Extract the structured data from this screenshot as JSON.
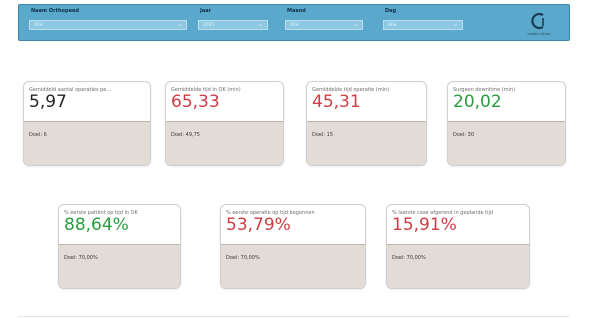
{
  "filters": [
    {
      "label": "Naam Orthopeed",
      "value": "Alle"
    },
    {
      "label": "Jaar",
      "value": "2021"
    },
    {
      "label": "Maand",
      "value": "Alle"
    },
    {
      "label": "Dag",
      "value": "Alle"
    }
  ],
  "logo": {
    "text": "cortex clinics"
  },
  "kpis_top": [
    {
      "title": "Gemiddeld aantal operaties pe...",
      "value": "5,97",
      "goal": "Doel: 6",
      "color": "black"
    },
    {
      "title": "Gemiddelde tijd in OK (min)",
      "value": "65,33",
      "goal": "Doel: 49,75",
      "color": "red"
    },
    {
      "title": "Gemiddelde tijd operatie (min)",
      "value": "45,31",
      "goal": "Doel: 15",
      "color": "red"
    },
    {
      "title": "Surgeon downtime (min)",
      "value": "20,02",
      "goal": "Doel: 30",
      "color": "green"
    }
  ],
  "kpis_bottom": [
    {
      "title": "% eerste patiënt op tijd in OK",
      "value": "88,64%",
      "goal": "Doel: 70,00%",
      "color": "green"
    },
    {
      "title": "% eerste operatie op tijd begonnen",
      "value": "53,79%",
      "goal": "Doel: 70,00%",
      "color": "red"
    },
    {
      "title": "% laatste case afgerond in geplande tijd",
      "value": "15,91%",
      "goal": "Doel: 70,00%",
      "color": "red"
    }
  ],
  "colors": {
    "red": "#cf3d45",
    "green": "#2a9d3e",
    "black": "#262626",
    "bar": "#5aa9cc"
  }
}
